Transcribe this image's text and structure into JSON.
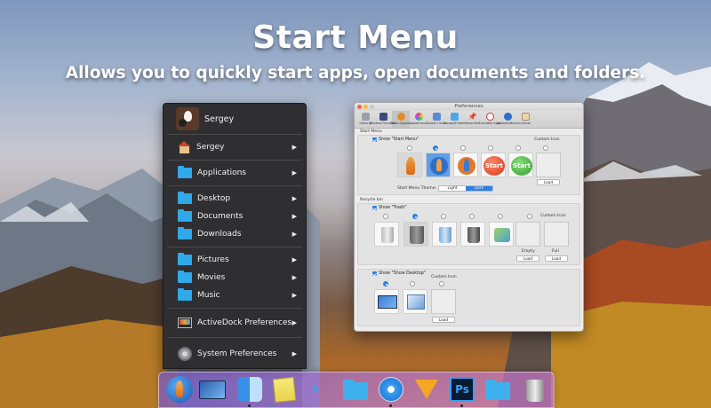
{
  "headline": {
    "title": "Start Menu",
    "subtitle": "Allows you to quickly start apps, open documents and folders."
  },
  "start_menu": {
    "user_name": "Sergey",
    "items": [
      {
        "label": "Sergey",
        "icon": "home-icon"
      },
      {
        "label": "Applications",
        "icon": "folder-icon"
      },
      {
        "label": "Desktop",
        "icon": "folder-icon"
      },
      {
        "label": "Documents",
        "icon": "folder-icon"
      },
      {
        "label": "Downloads",
        "icon": "folder-icon"
      },
      {
        "label": "Pictures",
        "icon": "folder-icon"
      },
      {
        "label": "Movies",
        "icon": "folder-icon"
      },
      {
        "label": "Music",
        "icon": "folder-icon"
      },
      {
        "label": "ActiveDock Preferences",
        "icon": "monitor-icon"
      },
      {
        "label": "System Preferences",
        "icon": "gear-icon"
      }
    ],
    "arrow": "▶"
  },
  "preferences": {
    "title": "Preferences",
    "toolbar": [
      "General",
      "Window Previews",
      "Dock Appear.",
      "Appearance",
      "Custom Icons",
      "Groups/Folders",
      "Favorites",
      "Excluded Apps",
      "Updates/Betas",
      "License"
    ],
    "start_section": {
      "title": "Start Menu",
      "checkbox": "Show \"Start Menu\"",
      "custom_icon": "Custom Icon",
      "start_label": "Start",
      "load": "Load",
      "theme_label": "Start Menu Theme:",
      "theme_light": "Light",
      "theme_dark": "Dark"
    },
    "trash_section": {
      "title": "Recycle bin",
      "checkbox": "Show \"Trash\"",
      "custom_icon": "Custom Icon",
      "empty": "Empty",
      "full": "Full",
      "load": "Load"
    },
    "desktop_section": {
      "checkbox": "Show \"Show Desktop\"",
      "custom_icon": "Custom Icon",
      "load": "Load"
    }
  },
  "dock": {
    "icons": [
      "rocket-icon",
      "monitor-icon",
      "finder-icon",
      "notes-icon",
      "activedock-icon",
      "folder-icon",
      "safari-icon",
      "sketch-icon",
      "photoshop-icon",
      "folder-icon",
      "trash-icon"
    ],
    "ps_label": "Ps"
  }
}
